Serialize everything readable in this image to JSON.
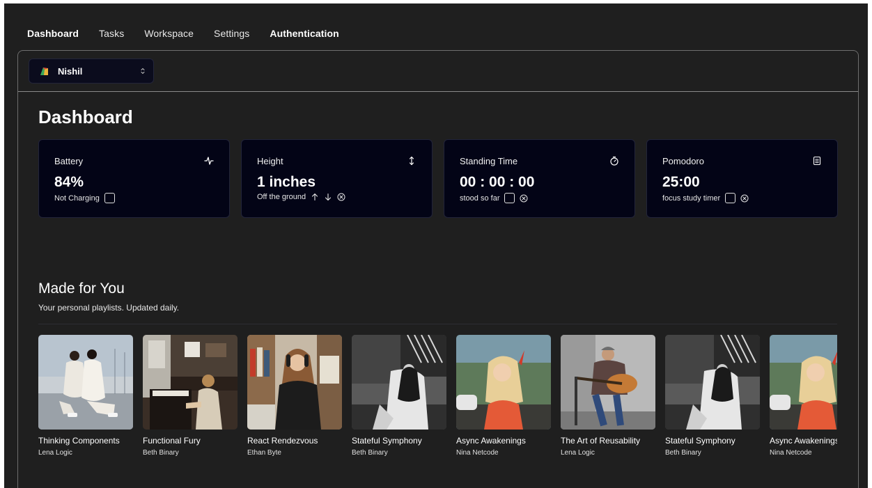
{
  "nav": {
    "items": [
      {
        "label": "Dashboard",
        "active": true
      },
      {
        "label": "Tasks",
        "active": false
      },
      {
        "label": "Workspace",
        "active": false
      },
      {
        "label": "Settings",
        "active": false
      },
      {
        "label": "Authentication",
        "active": true
      }
    ]
  },
  "team_switcher": {
    "name": "Nishil",
    "logo_icon": "team-logo-icon"
  },
  "page": {
    "title": "Dashboard"
  },
  "cards": [
    {
      "title": "Battery",
      "icon": "activity-icon",
      "value": "84%",
      "sub": "Not Charging"
    },
    {
      "title": "Height",
      "icon": "arrow-up-down-icon",
      "value": "1 inches",
      "sub": "Off the ground"
    },
    {
      "title": "Standing Time",
      "icon": "stopwatch-icon",
      "value": "00 : 00 : 00",
      "sub": "stood so far"
    },
    {
      "title": "Pomodoro",
      "icon": "clipboard-icon",
      "value": "25:00",
      "sub": "focus study timer"
    }
  ],
  "made_for_you": {
    "title": "Made for You",
    "subtitle": "Your personal playlists. Updated daily.",
    "albums": [
      {
        "title": "Thinking Components",
        "artist": "Lena Logic"
      },
      {
        "title": "Functional Fury",
        "artist": "Beth Binary"
      },
      {
        "title": "React Rendezvous",
        "artist": "Ethan Byte"
      },
      {
        "title": "Stateful Symphony",
        "artist": "Beth Binary"
      },
      {
        "title": "Async Awakenings",
        "artist": "Nina Netcode"
      },
      {
        "title": "The Art of Reusability",
        "artist": "Lena Logic"
      },
      {
        "title": "Stateful Symphony",
        "artist": "Beth Binary"
      },
      {
        "title": "Async Awakenings",
        "artist": "Nina Netcode"
      }
    ]
  },
  "colors": {
    "background": "#1f1f1f",
    "card": "#030416",
    "accent": "#ffffff"
  }
}
